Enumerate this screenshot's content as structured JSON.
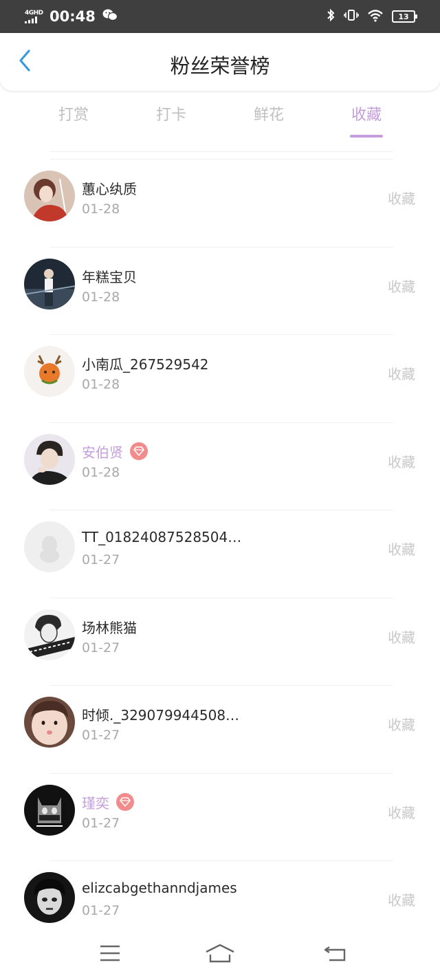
{
  "status_bar": {
    "network": "4GHD",
    "time": "00:48",
    "battery": "13"
  },
  "header": {
    "title": "粉丝荣誉榜"
  },
  "tabs": [
    {
      "label": "打赏",
      "active": false
    },
    {
      "label": "打卡",
      "active": false
    },
    {
      "label": "鲜花",
      "active": false
    },
    {
      "label": "收藏",
      "active": true
    }
  ],
  "rows": [
    {
      "name": "蕙心纨质",
      "date": "01-28",
      "action": "收藏",
      "vip": false
    },
    {
      "name": "年糕宝贝",
      "date": "01-28",
      "action": "收藏",
      "vip": false
    },
    {
      "name": "小南瓜_267529542",
      "date": "01-28",
      "action": "收藏",
      "vip": false
    },
    {
      "name": "安伯贤",
      "date": "01-28",
      "action": "收藏",
      "vip": true
    },
    {
      "name": "TT_01824087528504…",
      "date": "01-27",
      "action": "收藏",
      "vip": false
    },
    {
      "name": "场林熊猫",
      "date": "01-27",
      "action": "收藏",
      "vip": false
    },
    {
      "name": "时倾._329079944508…",
      "date": "01-27",
      "action": "收藏",
      "vip": false
    },
    {
      "name": "瑾奕",
      "date": "01-27",
      "action": "收藏",
      "vip": true
    },
    {
      "name": "elizcabgethanndjames",
      "date": "01-27",
      "action": "收藏",
      "vip": false
    }
  ],
  "colors": {
    "accent": "#c49ddd",
    "back_arrow": "#3a9bdc",
    "vip_badge": "#f28b8b",
    "muted_text": "#a8a8a8"
  },
  "icons": {
    "back": "chevron-left-icon",
    "vip": "diamond-icon",
    "nav_menu": "menu-icon",
    "nav_home": "home-icon",
    "nav_back": "back-icon"
  }
}
